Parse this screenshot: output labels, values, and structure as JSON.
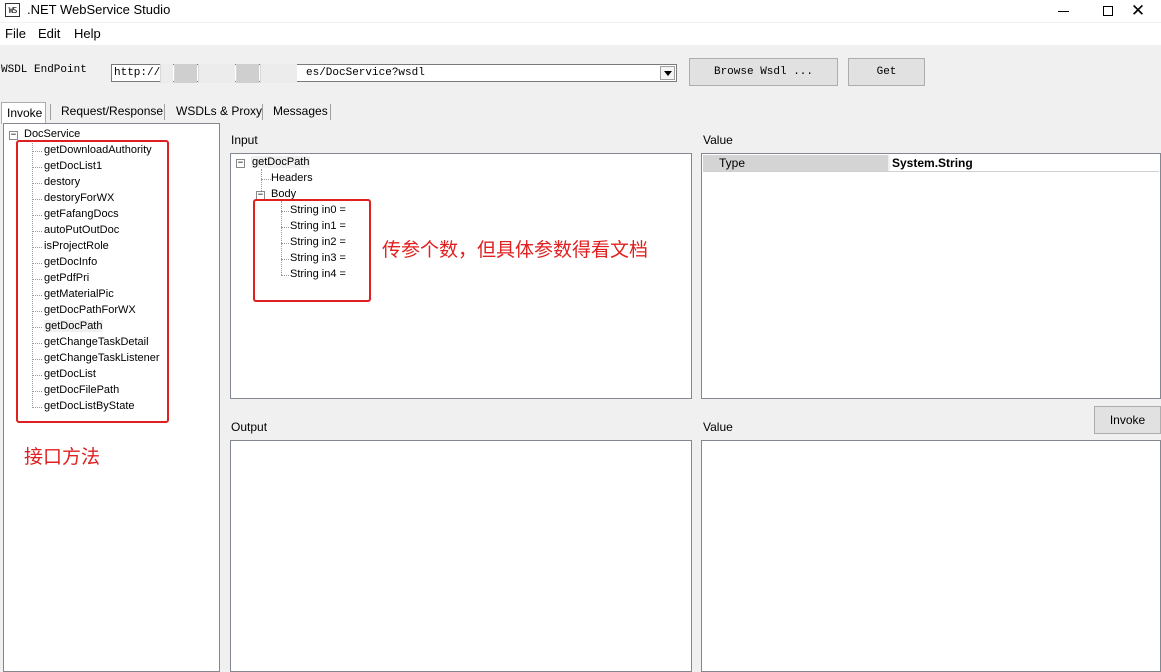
{
  "window": {
    "icon_text": "WS",
    "title": ".NET WebService Studio"
  },
  "menu": [
    "File",
    "Edit",
    "Help"
  ],
  "toolbar": {
    "endpoint_label": "WSDL EndPoint",
    "endpoint_prefix": "http://1",
    "endpoint_suffix": "es/DocService?wsdl",
    "browse_label": "Browse Wsdl ...",
    "get_label": "Get"
  },
  "tabs": [
    "Invoke",
    "Request/Response",
    "WSDLs & Proxy",
    "Messages"
  ],
  "methods": {
    "root": "DocService",
    "items": [
      "getDownloadAuthority",
      "getDocList1",
      "destory",
      "destoryForWX",
      "getFafangDocs",
      "autoPutOutDoc",
      "isProjectRole",
      "getDocInfo",
      "getPdfPri",
      "getMaterialPic",
      "getDocPathForWX",
      "getDocPath",
      "getChangeTaskDetail",
      "getChangeTaskListener",
      "getDocList",
      "getDocFilePath",
      "getDocListByState"
    ],
    "selected_index": 11
  },
  "input": {
    "label": "Input",
    "root": "getDocPath",
    "headers": "Headers",
    "body": "Body",
    "params": [
      "String in0 =",
      "String in1 =",
      "String in2 =",
      "String in3 =",
      "String in4 ="
    ]
  },
  "value_top": {
    "label": "Value",
    "key": "Type",
    "value": "System.String"
  },
  "output": {
    "label": "Output"
  },
  "value_bottom": {
    "label": "Value",
    "invoke_label": "Invoke"
  },
  "annotations": {
    "params_note": "传参个数，但具体参数得看文档",
    "methods_note": "接口方法",
    "color": "#e02020"
  }
}
